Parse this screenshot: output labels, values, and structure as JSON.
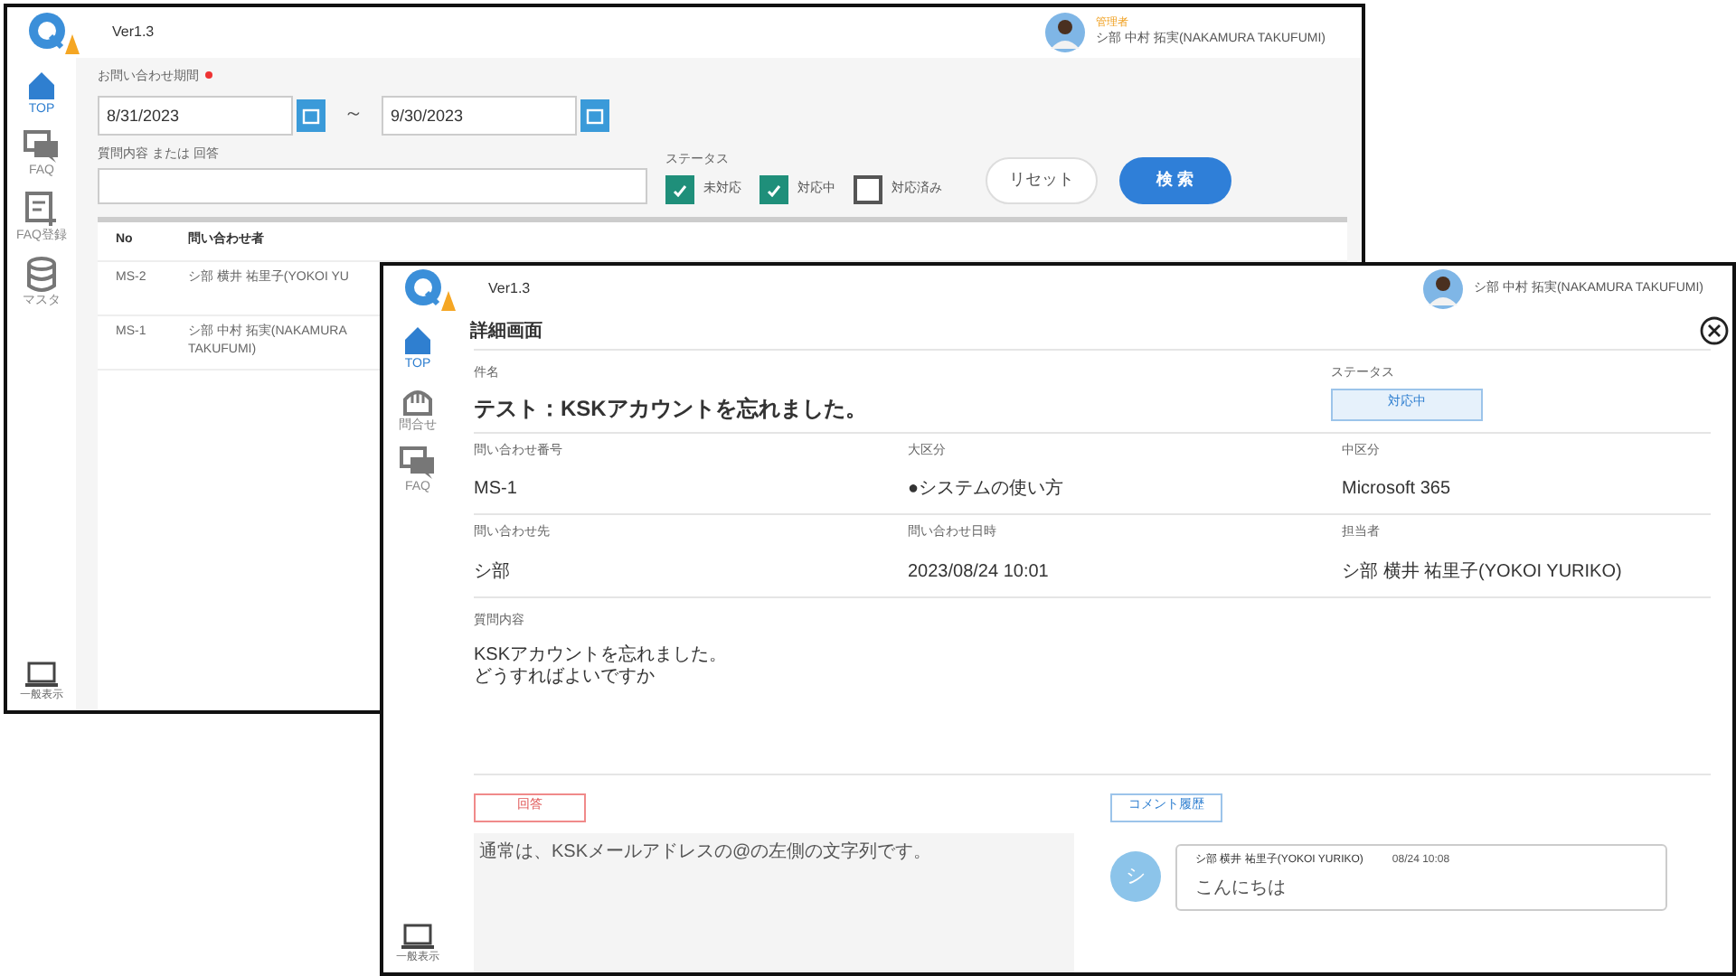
{
  "back_window": {
    "version": "Ver1.3",
    "user": {
      "role": "管理者",
      "name": "シ部 中村 拓実(NAKAMURA TAKUFUMI)"
    },
    "sidebar": [
      {
        "kind": "home",
        "label": "TOP",
        "selected": true
      },
      {
        "kind": "faq",
        "label": "FAQ",
        "selected": false
      },
      {
        "kind": "faq-add",
        "label": "FAQ登録",
        "selected": false
      },
      {
        "kind": "db",
        "label": "マスタ",
        "selected": false
      }
    ],
    "sidebar_bottom": {
      "label": "一般表示"
    },
    "period": {
      "label": "お問い合わせ期間",
      "required": true,
      "from": "8/31/2023",
      "separator": "～",
      "to": "9/30/2023"
    },
    "search": {
      "label": "質問内容 または 回答"
    },
    "status": {
      "label": "ステータス",
      "options": [
        {
          "label": "未対応",
          "checked": true
        },
        {
          "label": "対応中",
          "checked": true
        },
        {
          "label": "対応済み",
          "checked": false
        }
      ]
    },
    "buttons": [
      {
        "kind": "outline",
        "label": "リセット"
      },
      {
        "kind": "primary",
        "label": "検 索"
      }
    ],
    "table": {
      "columns": [
        "No",
        "問い合わせ者"
      ],
      "rows": [
        [
          "MS-2",
          "シ部 横井 祐里子(YOKOI YU"
        ],
        [
          "MS-1",
          "シ部 中村 拓実(NAKAMURA\nTAKUFUMI)"
        ]
      ]
    }
  },
  "front_window": {
    "version": "Ver1.3",
    "user": {
      "name": "シ部 中村 拓実(NAKAMURA TAKUFUMI)"
    },
    "sidebar": [
      {
        "kind": "home",
        "label": "TOP",
        "selected": true
      },
      {
        "kind": "hand",
        "label": "問合せ",
        "selected": false
      },
      {
        "kind": "faq",
        "label": "FAQ",
        "selected": false
      }
    ],
    "sidebar_bottom": {
      "label": "一般表示"
    },
    "title": "詳細画面",
    "subject": {
      "label": "件名",
      "value": "テスト：KSKアカウントを忘れました。"
    },
    "status": {
      "label": "ステータス",
      "value": "対応中"
    },
    "fields": [
      {
        "label": "問い合わせ番号",
        "value": "MS-1"
      },
      {
        "label": "大区分",
        "value": "●システムの使い方"
      },
      {
        "label": "中区分",
        "value": "Microsoft 365"
      },
      {
        "label": "問い合わせ先",
        "value": "シ部"
      },
      {
        "label": "問い合わせ日時",
        "value": "2023/08/24 10:01"
      },
      {
        "label": "担当者",
        "value": "シ部 横井 祐里子(YOKOI YURIKO)"
      }
    ],
    "question": {
      "label": "質問内容",
      "lines": [
        "KSKアカウントを忘れました。",
        "どうすればよいですか"
      ]
    },
    "answer": {
      "label": "回答",
      "value": "通常は、KSKメールアドレスの@の左側の文字列です。"
    },
    "comments": {
      "label": "コメント履歴",
      "items": [
        {
          "avatar": "シ",
          "author": "シ部 横井 祐里子(YOKOI YURIKO)",
          "time": "08/24 10:08",
          "text": "こんにちは"
        }
      ]
    }
  }
}
